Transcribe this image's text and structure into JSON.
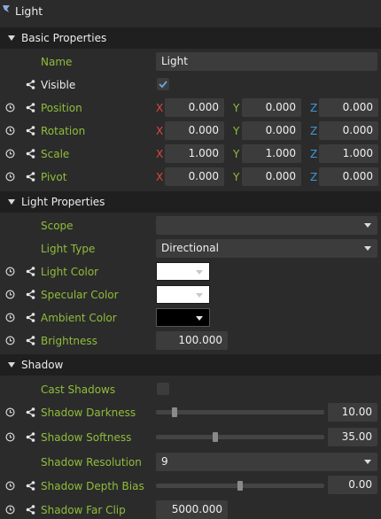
{
  "panel": {
    "title": "Light",
    "icon": "light-icon"
  },
  "colors": {
    "green_label": "#8fbd3a",
    "axis_x": "#e0473f",
    "axis_y": "#8fbd3a",
    "axis_z": "#3d9ad9",
    "section_bg": "#1f1f1f",
    "panel_bg": "#2b2b2b",
    "field_bg": "#3c3c3c"
  },
  "basic": {
    "title": "Basic Properties",
    "name_label": "Name",
    "name_value": "Light",
    "visible_label": "Visible",
    "visible_checked": true,
    "axis": {
      "x": "X",
      "y": "Y",
      "z": "Z"
    },
    "position": {
      "label": "Position",
      "x": "0.000",
      "y": "0.000",
      "z": "0.000"
    },
    "rotation": {
      "label": "Rotation",
      "x": "0.000",
      "y": "0.000",
      "z": "0.000"
    },
    "scale": {
      "label": "Scale",
      "x": "1.000",
      "y": "1.000",
      "z": "1.000"
    },
    "pivot": {
      "label": "Pivot",
      "x": "0.000",
      "y": "0.000",
      "z": "0.000"
    }
  },
  "light": {
    "title": "Light Properties",
    "scope_label": "Scope",
    "scope_value": "",
    "type_label": "Light Type",
    "type_value": "Directional",
    "light_color_label": "Light Color",
    "light_color": "#ffffff",
    "specular_label": "Specular Color",
    "specular_color": "#ffffff",
    "ambient_label": "Ambient Color",
    "ambient_color": "#000000",
    "brightness_label": "Brightness",
    "brightness_value": "100.000"
  },
  "shadow": {
    "title": "Shadow",
    "cast_label": "Cast Shadows",
    "cast_checked": false,
    "darkness_label": "Shadow Darkness",
    "darkness_value": "10.00",
    "darkness_fraction": 0.1,
    "softness_label": "Shadow Softness",
    "softness_value": "35.00",
    "softness_fraction": 0.35,
    "resolution_label": "Shadow Resolution",
    "resolution_value": "9",
    "depth_bias_label": "Shadow Depth Bias",
    "depth_bias_value": "0.00",
    "depth_bias_fraction": 0.5,
    "far_clip_label": "Shadow Far Clip",
    "far_clip_value": "5000.000"
  }
}
